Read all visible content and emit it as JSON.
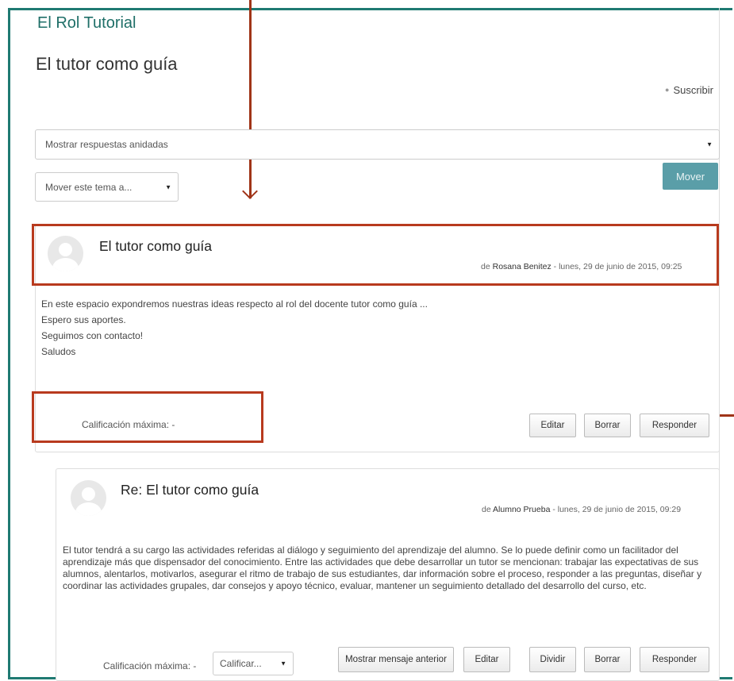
{
  "course_title": "El Rol Tutorial",
  "discussion_title": "El tutor como guía",
  "subscribe_label": "Suscribir",
  "display_mode": "Mostrar respuestas anidadas",
  "move_select": "Mover este tema a...",
  "move_button": "Mover",
  "posts": [
    {
      "subject": "El tutor como guía",
      "by": "de",
      "author": "Rosana Benitez",
      "date": " - lunes, 29 de junio de 2015, 09:25",
      "lines": [
        "En este espacio expondremos nuestras ideas respecto al rol del docente tutor como guía ...",
        "Espero sus aportes.",
        "Seguimos con contacto!",
        "Saludos"
      ],
      "grade": "Calificación máxima: -",
      "buttons": [
        "Editar",
        "Borrar",
        "Responder"
      ]
    },
    {
      "subject": "Re: El tutor como guía",
      "by": "de",
      "author": "Alumno Prueba",
      "date": " - lunes, 29 de junio de 2015, 09:29",
      "text": "El tutor tendrá a su cargo las actividades referidas al diálogo y seguimiento del aprendizaje del alumno. Se lo puede definir como un facilitador del aprendizaje más que dispensador del conocimiento. Entre las actividades que debe desarrollar un tutor se mencionan: trabajar las expectativas de sus alumnos, alentarlos, motivarlos, asegurar el ritmo de trabajo de sus estudiantes, dar información sobre el proceso, responder a las preguntas, diseñar y coordinar las actividades grupales, dar consejos y apoyo técnico, evaluar, mantener un seguimiento detallado del desarrollo del curso, etc.",
      "grade": "Calificación máxima: -",
      "rate_select": "Calificar...",
      "buttons": [
        "Mostrar mensaje anterior",
        "Editar",
        "Dividir",
        "Borrar",
        "Responder"
      ]
    }
  ],
  "colors": {
    "accent": "#1f6f68",
    "annotation": "#b83a1e",
    "move_button": "#5a9ea8"
  }
}
